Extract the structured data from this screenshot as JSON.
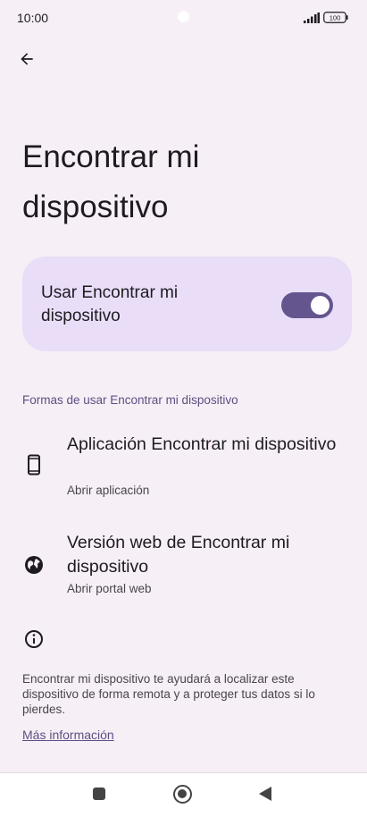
{
  "status_bar": {
    "time": "10:00",
    "battery": "100"
  },
  "header": {
    "back_icon": "arrow-left-icon"
  },
  "page": {
    "title": "Encontrar mi dispositivo"
  },
  "main_toggle": {
    "label": "Usar Encontrar mi dispositivo",
    "state": "on",
    "accent_color": "#65558F",
    "card_color": "#E9DDF8"
  },
  "section": {
    "header": "Formas de usar Encontrar mi dispositivo",
    "options": [
      {
        "icon": "phone-icon",
        "title": "Aplicación Encontrar mi dispositivo",
        "subtitle": "Abrir aplicación"
      },
      {
        "icon": "globe-icon",
        "title": "Versión web de Encontrar mi dispositivo",
        "subtitle": "Abrir portal web"
      }
    ]
  },
  "info": {
    "icon": "info-icon",
    "text": "Encontrar mi dispositivo te ayudará a localizar este dispositivo de forma remota y a proteger tus datos si lo pierdes.",
    "link": "Más información"
  },
  "nav_bar": {
    "recents_icon": "square-icon",
    "home_icon": "circle-icon",
    "back_icon": "triangle-back-icon"
  }
}
